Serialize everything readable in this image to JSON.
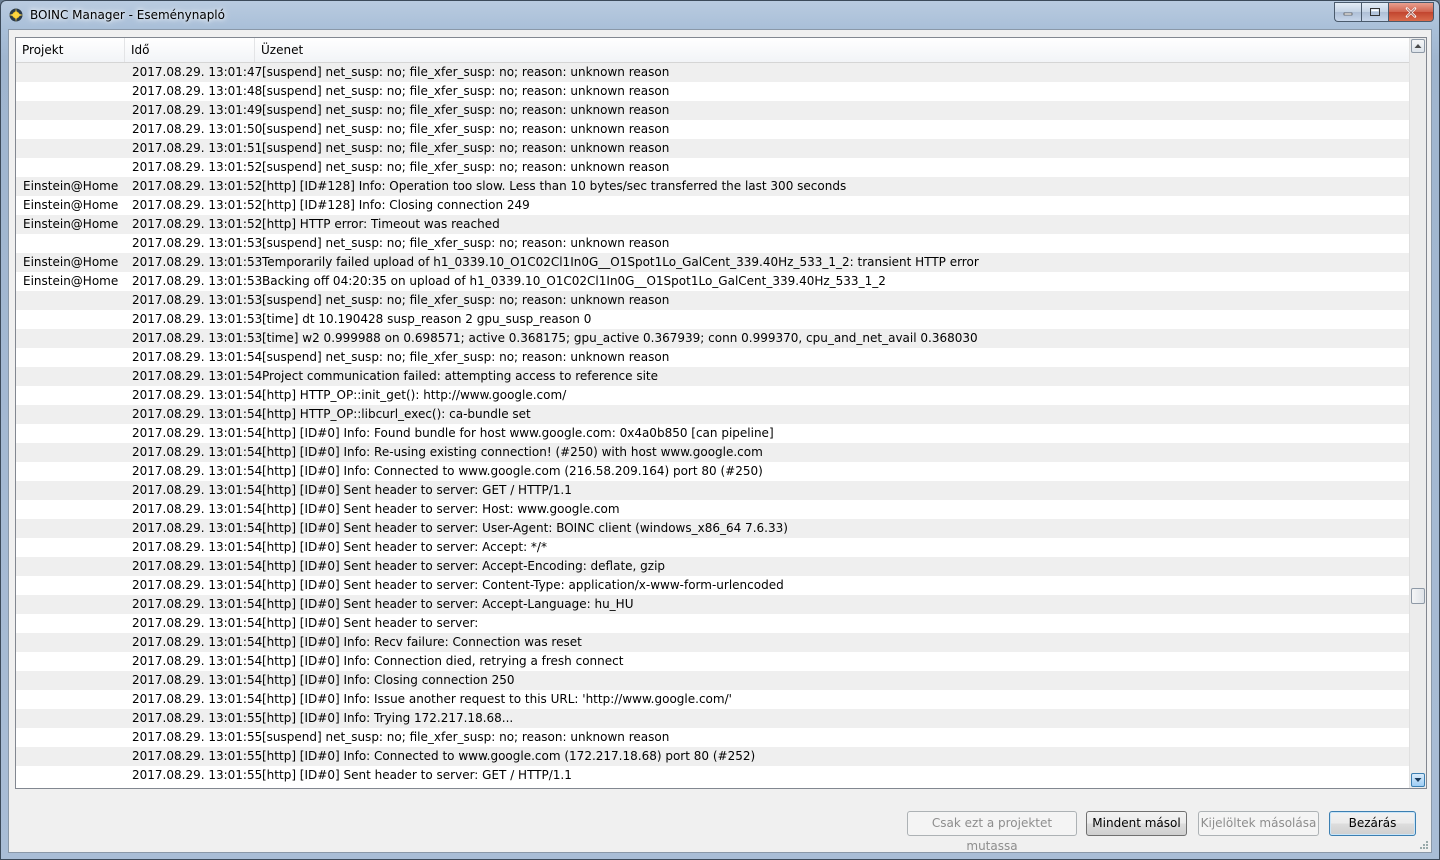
{
  "window": {
    "title": "BOINC Manager - Eseménynapló"
  },
  "columns": {
    "project": "Projekt",
    "time": "Idő",
    "message": "Üzenet"
  },
  "rows": [
    {
      "project": "",
      "time": "2017.08.29. 13:01:47",
      "message": "[suspend] net_susp: no; file_xfer_susp: no; reason: unknown reason"
    },
    {
      "project": "",
      "time": "2017.08.29. 13:01:48",
      "message": "[suspend] net_susp: no; file_xfer_susp: no; reason: unknown reason"
    },
    {
      "project": "",
      "time": "2017.08.29. 13:01:49",
      "message": "[suspend] net_susp: no; file_xfer_susp: no; reason: unknown reason"
    },
    {
      "project": "",
      "time": "2017.08.29. 13:01:50",
      "message": "[suspend] net_susp: no; file_xfer_susp: no; reason: unknown reason"
    },
    {
      "project": "",
      "time": "2017.08.29. 13:01:51",
      "message": "[suspend] net_susp: no; file_xfer_susp: no; reason: unknown reason"
    },
    {
      "project": "",
      "time": "2017.08.29. 13:01:52",
      "message": "[suspend] net_susp: no; file_xfer_susp: no; reason: unknown reason"
    },
    {
      "project": "Einstein@Home",
      "time": "2017.08.29. 13:01:52",
      "message": "[http] [ID#128] Info:  Operation too slow. Less than 10 bytes/sec transferred the last 300 seconds"
    },
    {
      "project": "Einstein@Home",
      "time": "2017.08.29. 13:01:52",
      "message": "[http] [ID#128] Info:  Closing connection 249"
    },
    {
      "project": "Einstein@Home",
      "time": "2017.08.29. 13:01:52",
      "message": "[http] HTTP error: Timeout was reached"
    },
    {
      "project": "",
      "time": "2017.08.29. 13:01:53",
      "message": "[suspend] net_susp: no; file_xfer_susp: no; reason: unknown reason"
    },
    {
      "project": "Einstein@Home",
      "time": "2017.08.29. 13:01:53",
      "message": "Temporarily failed upload of h1_0339.10_O1C02Cl1In0G__O1Spot1Lo_GalCent_339.40Hz_533_1_2: transient HTTP error"
    },
    {
      "project": "Einstein@Home",
      "time": "2017.08.29. 13:01:53",
      "message": "Backing off 04:20:35 on upload of h1_0339.10_O1C02Cl1In0G__O1Spot1Lo_GalCent_339.40Hz_533_1_2"
    },
    {
      "project": "",
      "time": "2017.08.29. 13:01:53",
      "message": "[suspend] net_susp: no; file_xfer_susp: no; reason: unknown reason"
    },
    {
      "project": "",
      "time": "2017.08.29. 13:01:53",
      "message": "[time] dt 10.190428 susp_reason 2 gpu_susp_reason 0"
    },
    {
      "project": "",
      "time": "2017.08.29. 13:01:53",
      "message": "[time] w2 0.999988 on 0.698571; active 0.368175; gpu_active 0.367939; conn 0.999370, cpu_and_net_avail 0.368030"
    },
    {
      "project": "",
      "time": "2017.08.29. 13:01:54",
      "message": "[suspend] net_susp: no; file_xfer_susp: no; reason: unknown reason"
    },
    {
      "project": "",
      "time": "2017.08.29. 13:01:54",
      "message": "Project communication failed: attempting access to reference site"
    },
    {
      "project": "",
      "time": "2017.08.29. 13:01:54",
      "message": "[http] HTTP_OP::init_get(): http://www.google.com/"
    },
    {
      "project": "",
      "time": "2017.08.29. 13:01:54",
      "message": "[http] HTTP_OP::libcurl_exec(): ca-bundle set"
    },
    {
      "project": "",
      "time": "2017.08.29. 13:01:54",
      "message": "[http] [ID#0] Info:  Found bundle for host www.google.com: 0x4a0b850 [can pipeline]"
    },
    {
      "project": "",
      "time": "2017.08.29. 13:01:54",
      "message": "[http] [ID#0] Info:  Re-using existing connection! (#250) with host www.google.com"
    },
    {
      "project": "",
      "time": "2017.08.29. 13:01:54",
      "message": "[http] [ID#0] Info:  Connected to www.google.com (216.58.209.164) port 80 (#250)"
    },
    {
      "project": "",
      "time": "2017.08.29. 13:01:54",
      "message": "[http] [ID#0] Sent header to server: GET / HTTP/1.1"
    },
    {
      "project": "",
      "time": "2017.08.29. 13:01:54",
      "message": "[http] [ID#0] Sent header to server: Host: www.google.com"
    },
    {
      "project": "",
      "time": "2017.08.29. 13:01:54",
      "message": "[http] [ID#0] Sent header to server: User-Agent: BOINC client (windows_x86_64 7.6.33)"
    },
    {
      "project": "",
      "time": "2017.08.29. 13:01:54",
      "message": "[http] [ID#0] Sent header to server: Accept: */*"
    },
    {
      "project": "",
      "time": "2017.08.29. 13:01:54",
      "message": "[http] [ID#0] Sent header to server: Accept-Encoding: deflate, gzip"
    },
    {
      "project": "",
      "time": "2017.08.29. 13:01:54",
      "message": "[http] [ID#0] Sent header to server: Content-Type: application/x-www-form-urlencoded"
    },
    {
      "project": "",
      "time": "2017.08.29. 13:01:54",
      "message": "[http] [ID#0] Sent header to server: Accept-Language: hu_HU"
    },
    {
      "project": "",
      "time": "2017.08.29. 13:01:54",
      "message": "[http] [ID#0] Sent header to server:"
    },
    {
      "project": "",
      "time": "2017.08.29. 13:01:54",
      "message": "[http] [ID#0] Info:  Recv failure: Connection was reset"
    },
    {
      "project": "",
      "time": "2017.08.29. 13:01:54",
      "message": "[http] [ID#0] Info:  Connection died, retrying a fresh connect"
    },
    {
      "project": "",
      "time": "2017.08.29. 13:01:54",
      "message": "[http] [ID#0] Info:  Closing connection 250"
    },
    {
      "project": "",
      "time": "2017.08.29. 13:01:54",
      "message": "[http] [ID#0] Info:  Issue another request to this URL: 'http://www.google.com/'"
    },
    {
      "project": "",
      "time": "2017.08.29. 13:01:55",
      "message": "[http] [ID#0] Info:    Trying 172.217.18.68..."
    },
    {
      "project": "",
      "time": "2017.08.29. 13:01:55",
      "message": "[suspend] net_susp: no; file_xfer_susp: no; reason: unknown reason"
    },
    {
      "project": "",
      "time": "2017.08.29. 13:01:55",
      "message": "[http] [ID#0] Info:  Connected to www.google.com (172.217.18.68) port 80 (#252)"
    },
    {
      "project": "",
      "time": "2017.08.29. 13:01:55",
      "message": "[http] [ID#0] Sent header to server: GET / HTTP/1.1"
    }
  ],
  "buttons": {
    "only_project": "Csak ezt a projektet mutassa",
    "copy_all": "Mindent másol",
    "copy_selected": "Kijelöltek másolása",
    "close": "Bezárás"
  },
  "colors": {
    "title_bar": "#a9bfd8",
    "row_alt": "#efefef",
    "default_button_border": "#3c7fb1"
  },
  "scrollbar": {
    "position_fraction": 0.76
  }
}
